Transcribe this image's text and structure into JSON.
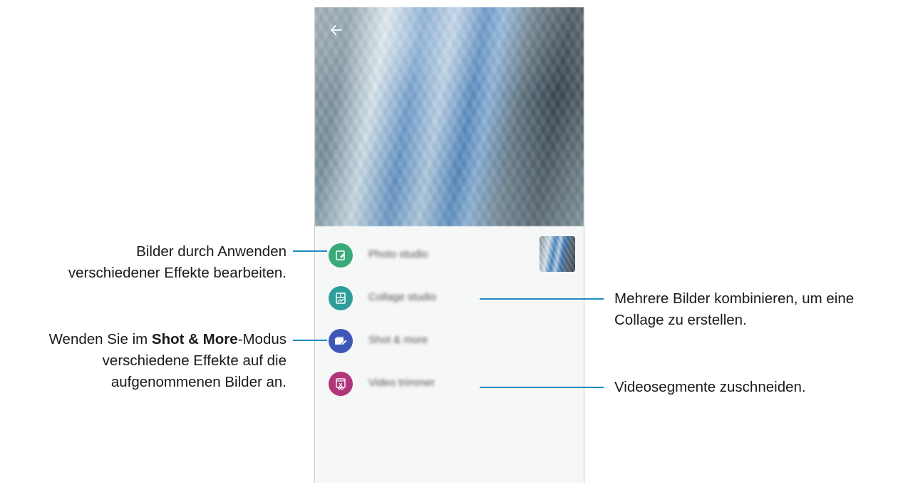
{
  "menu": {
    "items": [
      {
        "label": "Photo studio",
        "color": "#3aaa7a"
      },
      {
        "label": "Collage studio",
        "color": "#2e9e9a"
      },
      {
        "label": "Shot & more",
        "color": "#3d57b8"
      },
      {
        "label": "Video trimmer",
        "color": "#b0357a"
      }
    ]
  },
  "annotations": {
    "photo_studio": {
      "line1": "Bilder durch Anwenden",
      "line2": "verschiedener Effekte bearbeiten."
    },
    "collage": {
      "line1": "Mehrere Bilder kombinieren, um eine",
      "line2": "Collage zu erstellen."
    },
    "shot_more": {
      "prefix": "Wenden Sie im ",
      "bold": "Shot & More",
      "suffix": "-Modus",
      "line2": "verschiedene Effekte auf die",
      "line3": "aufgenommenen Bilder an."
    },
    "video": {
      "line1": "Videosegmente zuschneiden."
    }
  },
  "colors": {
    "callout_line": "#1f8ac4",
    "background": "#f6f7f7"
  },
  "icons": {
    "back": "arrow-left-icon",
    "photo_studio": "photo-edit-icon",
    "collage": "collage-icon",
    "shot_more": "shot-more-icon",
    "video": "video-trim-icon"
  }
}
